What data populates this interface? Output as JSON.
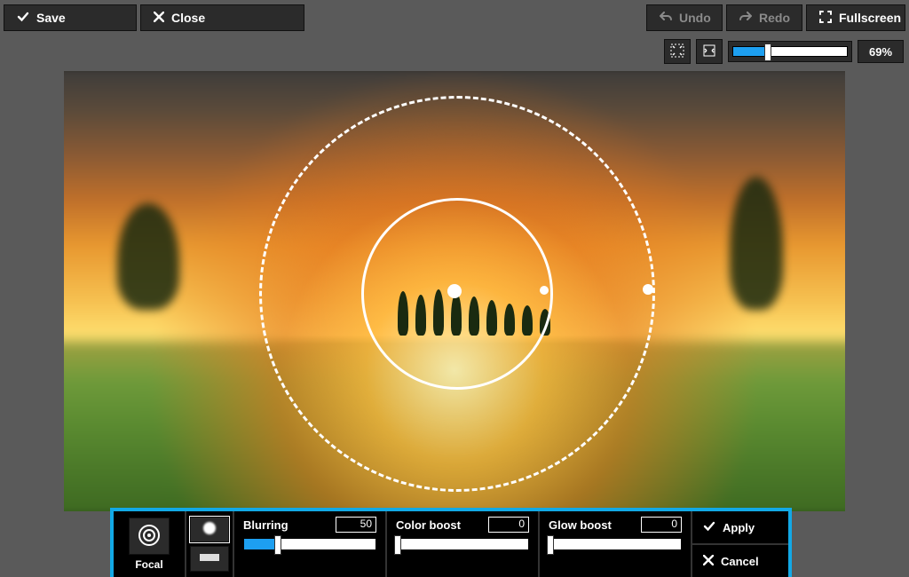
{
  "toolbar": {
    "save": "Save",
    "close": "Close",
    "undo": "Undo",
    "redo": "Redo",
    "fullscreen": "Fullscreen"
  },
  "zoom": {
    "value_label": "69%",
    "percent": 30
  },
  "focal_panel": {
    "tool_label": "Focal",
    "params": {
      "blurring": {
        "label": "Blurring",
        "value": 50,
        "percent": 25
      },
      "color_boost": {
        "label": "Color boost",
        "value": 0,
        "percent": 0
      },
      "glow_boost": {
        "label": "Glow boost",
        "value": 0,
        "percent": 0
      }
    },
    "apply": "Apply",
    "cancel": "Cancel"
  }
}
